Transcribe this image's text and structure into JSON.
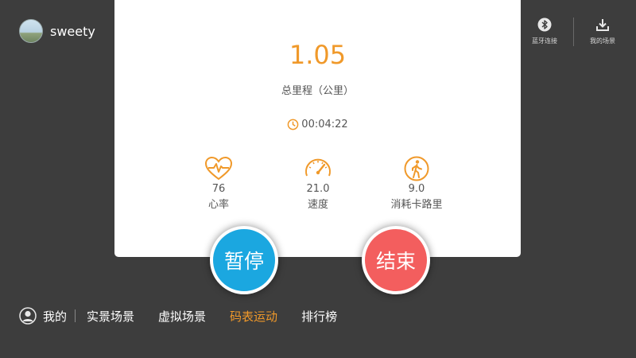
{
  "user": {
    "name": "sweety"
  },
  "top_right": {
    "bluetooth_label": "蓝牙连接",
    "my_scenes_label": "我的场景"
  },
  "workout": {
    "distance": "1.05",
    "distance_label": "总里程（公里）",
    "elapsed_time": "00:04:22",
    "stats": [
      {
        "icon": "heart-rate-icon",
        "value": "76",
        "label": "心率"
      },
      {
        "icon": "speedometer-icon",
        "value": "21.0",
        "label": "速度"
      },
      {
        "icon": "walker-icon",
        "value": "9.0",
        "label": "消耗卡路里"
      }
    ]
  },
  "controls": {
    "pause_label": "暂停",
    "end_label": "结束"
  },
  "nav": {
    "me_label": "我的",
    "items": [
      {
        "label": "实景场景",
        "active": false
      },
      {
        "label": "虚拟场景",
        "active": false
      },
      {
        "label": "码表运动",
        "active": true
      },
      {
        "label": "排行榜",
        "active": false
      }
    ]
  },
  "colors": {
    "accent": "#f0992a",
    "pause": "#1ba7e0",
    "end": "#f35e5e",
    "background": "#3d3d3d"
  }
}
